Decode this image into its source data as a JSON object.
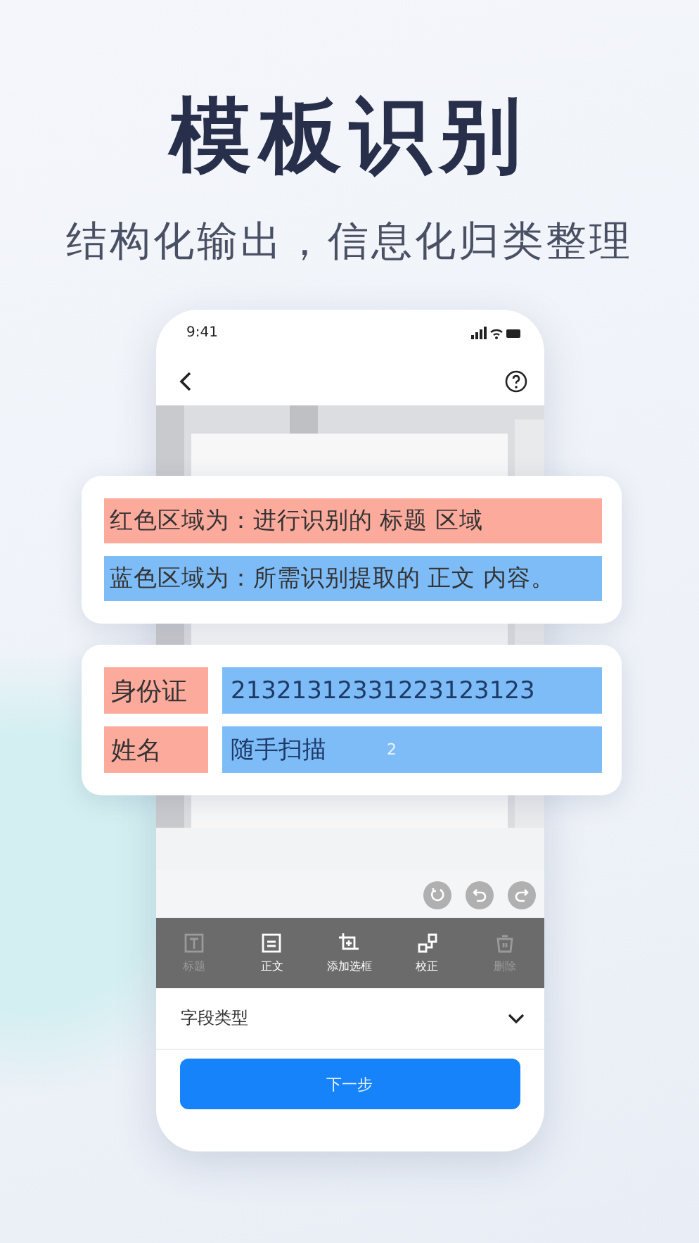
{
  "headline": "模板识别",
  "subheadline": "结构化输出，信息化归类整理",
  "phone": {
    "status_time": "9:41",
    "tools": [
      {
        "label": "标题",
        "disabled": true,
        "kind": "title"
      },
      {
        "label": "正文",
        "disabled": false,
        "kind": "body"
      },
      {
        "label": "添加选框",
        "disabled": false,
        "kind": "add"
      },
      {
        "label": "校正",
        "disabled": false,
        "kind": "correct"
      },
      {
        "label": "删除",
        "disabled": true,
        "kind": "delete"
      }
    ],
    "field_type": {
      "label": "字段类型",
      "expanded": false
    },
    "next_button": "下一步"
  },
  "legend_card": [
    {
      "text": "红色区域为：进行识别的 标题 区域",
      "color": "#fcaa9c"
    },
    {
      "text": "蓝色区域为：所需识别提取的 正文 内容。",
      "color": "#7ebcf8"
    }
  ],
  "fields_card": [
    {
      "label": "身份证",
      "value": "21321312331223123123"
    },
    {
      "label": "姓名",
      "value": "随手扫描",
      "value_marker": "2"
    }
  ]
}
